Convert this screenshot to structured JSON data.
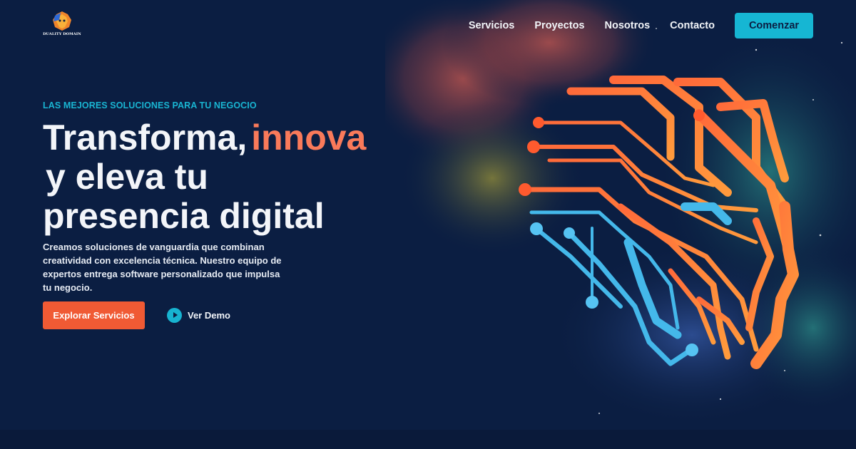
{
  "brand": {
    "logo_text": "DUALITY DOMAIN",
    "logo_icon": "lion-head-logo"
  },
  "nav": {
    "items": [
      {
        "label": "Servicios"
      },
      {
        "label": "Proyectos"
      },
      {
        "label": "Nosotros"
      },
      {
        "label": "Contacto"
      }
    ],
    "cta_label": "Comenzar"
  },
  "hero": {
    "eyebrow": "LAS MEJORES SOLUCIONES PARA TU NEGOCIO",
    "headline_part1": "Transforma,",
    "headline_accent": "innova",
    "headline_part2": "y eleva tu",
    "headline_part3": "presencia digital",
    "description": "Creamos soluciones de vanguardia que combinan creatividad con excelencia técnica. Nuestro equipo de expertos entrega software personalizado que impulsa tu negocio.",
    "primary_button": "Explorar Servicios",
    "demo_button": "Ver Demo",
    "demo_icon": "play-icon",
    "art_icon": "circuit-face-illustration"
  },
  "colors": {
    "background": "#0b1e42",
    "accent_cyan": "#16b6d3",
    "accent_orange": "#f05a34",
    "headline_accent": "#f97a5a"
  }
}
